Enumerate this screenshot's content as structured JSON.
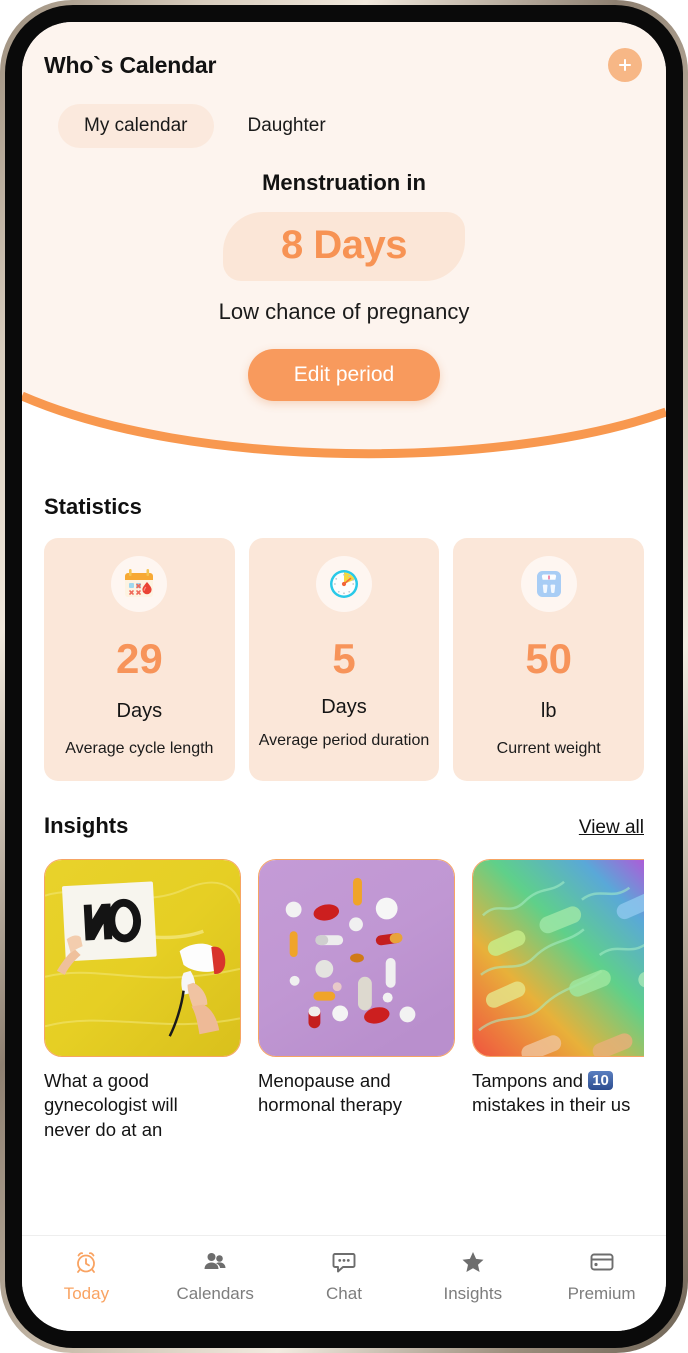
{
  "header": {
    "title": "Who`s Calendar",
    "add_button_label": "+",
    "add_icon": "plus-icon"
  },
  "tabs": [
    {
      "label": "My calendar",
      "active": true
    },
    {
      "label": "Daughter",
      "active": false
    }
  ],
  "hero": {
    "menstruation_label": "Menstruation in",
    "days_badge": "8 Days",
    "pregnancy_chance": "Low chance of pregnancy",
    "edit_button": "Edit period",
    "badge_bg": "#fbe6d7",
    "badge_text_color": "#f79354",
    "bg_color": "#fdf4ee",
    "accent_color": "#f89a5d",
    "wave_color": "#f8984f"
  },
  "statistics": {
    "title": "Statistics",
    "cards": [
      {
        "icon": "calendar-blood-drop-icon",
        "value": "29",
        "unit": "Days",
        "description": "Average cycle length"
      },
      {
        "icon": "timer-clock-icon",
        "value": "5",
        "unit": "Days",
        "description": "Average period\nduration"
      },
      {
        "icon": "weight-scale-icon",
        "value": "50",
        "unit": "lb",
        "description": "Current weight"
      }
    ]
  },
  "insights": {
    "title": "Insights",
    "view_all_label": "View all",
    "cards": [
      {
        "image": "yellow-no-sign-megaphone-photo",
        "caption": "What a good\ngynecologist will\nnever do at an"
      },
      {
        "image": "purple-pills-photo",
        "caption": "Menopause and\nhormonal therapy"
      },
      {
        "image": "rainbow-tampons-photo",
        "caption_before": "Tampons and ",
        "caption_badge": "10",
        "caption_after": "\nmistakes in their us"
      }
    ]
  },
  "bottom_nav": [
    {
      "label": "Today",
      "icon": "alarm-clock-icon",
      "active": true
    },
    {
      "label": "Calendars",
      "icon": "people-icon",
      "active": false
    },
    {
      "label": "Chat",
      "icon": "chat-bubble-icon",
      "active": false
    },
    {
      "label": "Insights",
      "icon": "star-icon",
      "active": false
    },
    {
      "label": "Premium",
      "icon": "credit-card-icon",
      "active": false
    }
  ]
}
